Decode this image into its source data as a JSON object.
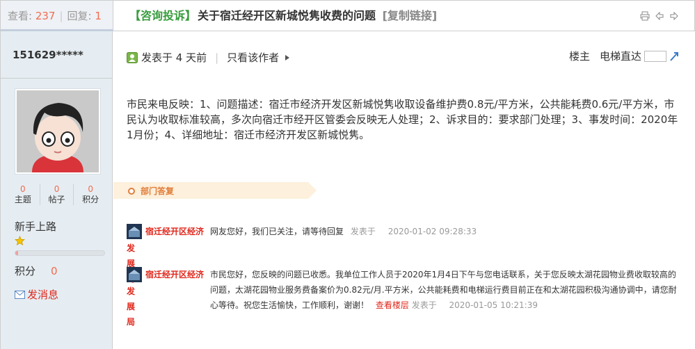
{
  "header": {
    "views_label": "查看:",
    "views": "237",
    "replies_label": "回复:",
    "replies": "1",
    "category": "【咨询投诉】",
    "title": "关于宿迁经开区新城悦隽收费的问题",
    "copy_link": "[复制链接]",
    "icons": [
      "printer-icon",
      "prev-arrow-icon",
      "next-arrow-icon"
    ]
  },
  "author": {
    "username": "151629*****",
    "stats": [
      {
        "value": "0",
        "label": "主题"
      },
      {
        "value": "0",
        "label": "帖子"
      },
      {
        "value": "0",
        "label": "积分"
      }
    ],
    "rank": "新手上路",
    "points_label": "积分",
    "points": "0",
    "message_label": "发消息"
  },
  "post": {
    "posted": "发表于 4 天前",
    "only_author": "只看该作者",
    "floor": "楼主",
    "elevator": "电梯直达",
    "content": "市民来电反映：1、问题描述：宿迁市经济开发区新城悦隽收取设备维护费0.8元/平方米，公共能耗费0.6元/平方米，市民认为收取标准较高，多次向宿迁市经开区管委会反映无人处理；2、诉求目的：要求部门处理；3、事发时间：2020年1月份；4、详细地址：宿迁市经济开发区新城悦隽。"
  },
  "replies_section": {
    "heading": "部门答复",
    "items": [
      {
        "dept_line1": "宿迁经开区经济",
        "dept_line2": "发展局",
        "text": "网友您好，我们已关注，请等待回复",
        "posted_label": "发表于",
        "time": "2020-01-02 09:28:33"
      },
      {
        "dept_line1": "宿迁经开区经济",
        "dept_line2": "发展局",
        "text": "市民您好，您反映的问题已收悉。我单位工作人员于2020年1月4日下午与您电话联系，关于您反映太湖花园物业费收取较高的问题，太湖花园物业服务费备案价为0.82元/月.平方米，公共能耗费和电梯运行费目前正在和太湖花园积极沟通协调中，请您耐心等待。祝您生活愉快，工作顺利，谢谢！",
        "view_floor": "查看楼层",
        "posted_label": "发表于",
        "time": "2020-01-05 10:21:39"
      }
    ]
  },
  "colors": {
    "accent_red": "#e0281c",
    "category_green": "#369c3c",
    "orange": "#f26c4f",
    "sidebar_bg": "#e5edf2"
  }
}
